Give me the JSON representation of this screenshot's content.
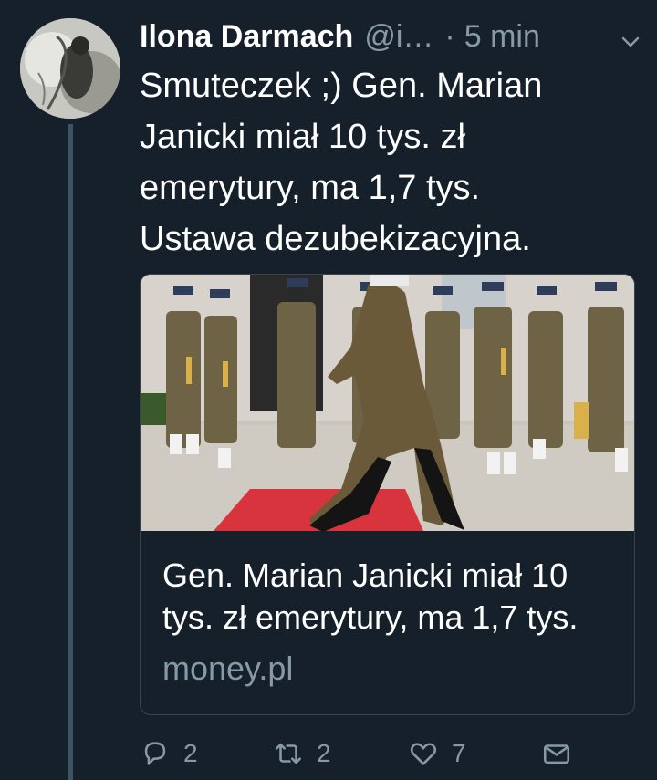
{
  "tweet": {
    "display_name": "Ilona Darmach",
    "handle": "@i…",
    "separator": "·",
    "time": "5 min",
    "text": "Smuteczek ;) Gen. Marian\nJanicki miał 10 tys. zł\nemerytury, ma 1,7 tys.\nUstawa dezubekizacyjna."
  },
  "card": {
    "title": "Gen. Marian Janicki miał 10 tys. zł emerytury, ma 1,7 tys.",
    "domain": "money.pl"
  },
  "actions": {
    "reply_count": "2",
    "retweet_count": "2",
    "like_count": "7"
  },
  "icons": {
    "menu": "chevron-down-icon",
    "reply": "reply-icon",
    "retweet": "retweet-icon",
    "like": "heart-icon",
    "dm": "envelope-icon"
  },
  "colors": {
    "background": "#15202b",
    "secondary_text": "#8899a6",
    "thread_line": "#3d5466",
    "card_border": "#38444d"
  }
}
